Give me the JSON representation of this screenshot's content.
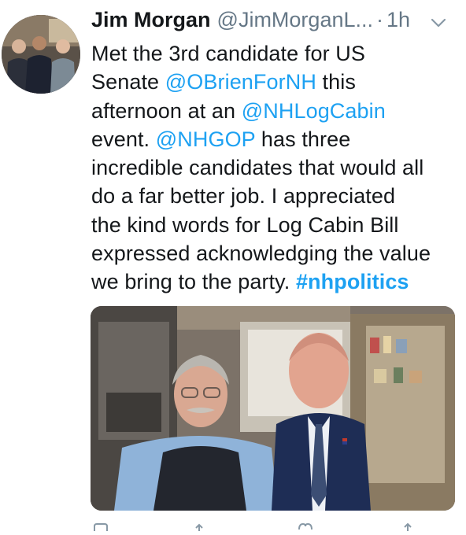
{
  "tweet": {
    "author_name": "Jim Morgan",
    "author_handle": "@JimMorganL...",
    "separator": "·",
    "time": "1h",
    "text_lines": [
      [
        {
          "t": "Met the 3rd candidate for US",
          "k": "plain"
        }
      ],
      [
        {
          "t": "Senate ",
          "k": "plain"
        },
        {
          "t": "@OBrienForNH",
          "k": "mention"
        },
        {
          "t": " this",
          "k": "plain"
        }
      ],
      [
        {
          "t": "afternoon at an ",
          "k": "plain"
        },
        {
          "t": "@NHLogCabin",
          "k": "mention"
        }
      ],
      [
        {
          "t": "event. ",
          "k": "plain"
        },
        {
          "t": "@NHGOP",
          "k": "mention"
        },
        {
          "t": " has three",
          "k": "plain"
        }
      ],
      [
        {
          "t": "incredible candidates that would all",
          "k": "plain"
        }
      ],
      [
        {
          "t": "do a far better job. I appreciated",
          "k": "plain"
        }
      ],
      [
        {
          "t": "the kind words for Log Cabin Bill",
          "k": "plain"
        }
      ],
      [
        {
          "t": "expressed acknowledging the value",
          "k": "plain"
        }
      ],
      [
        {
          "t": "we bring to the party. ",
          "k": "plain"
        },
        {
          "t": "#nhpolitics",
          "k": "hashtag"
        }
      ]
    ]
  },
  "colors": {
    "link": "#1da1f2",
    "secondary_text": "#657786",
    "primary_text": "#14171a"
  },
  "icons": {
    "menu": "chevron-down-icon",
    "reply": "reply-icon",
    "retweet": "retweet-icon",
    "like": "heart-icon",
    "share": "share-icon"
  }
}
